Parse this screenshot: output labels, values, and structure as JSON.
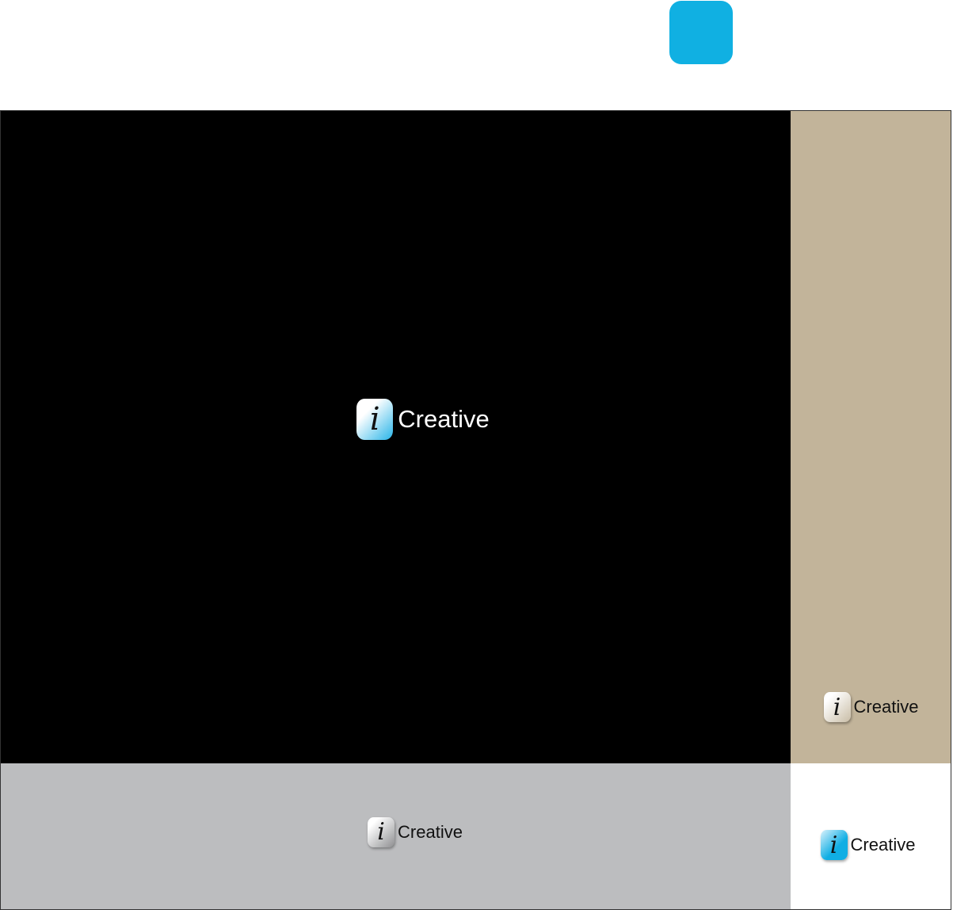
{
  "brand": {
    "name": "Creative",
    "mark": "i"
  },
  "colors": {
    "swatch": "#10b0e2",
    "black_panel": "#000000",
    "tan_panel": "#c2b49a",
    "gray_panel": "#bcbdbf",
    "white_panel": "#ffffff"
  }
}
